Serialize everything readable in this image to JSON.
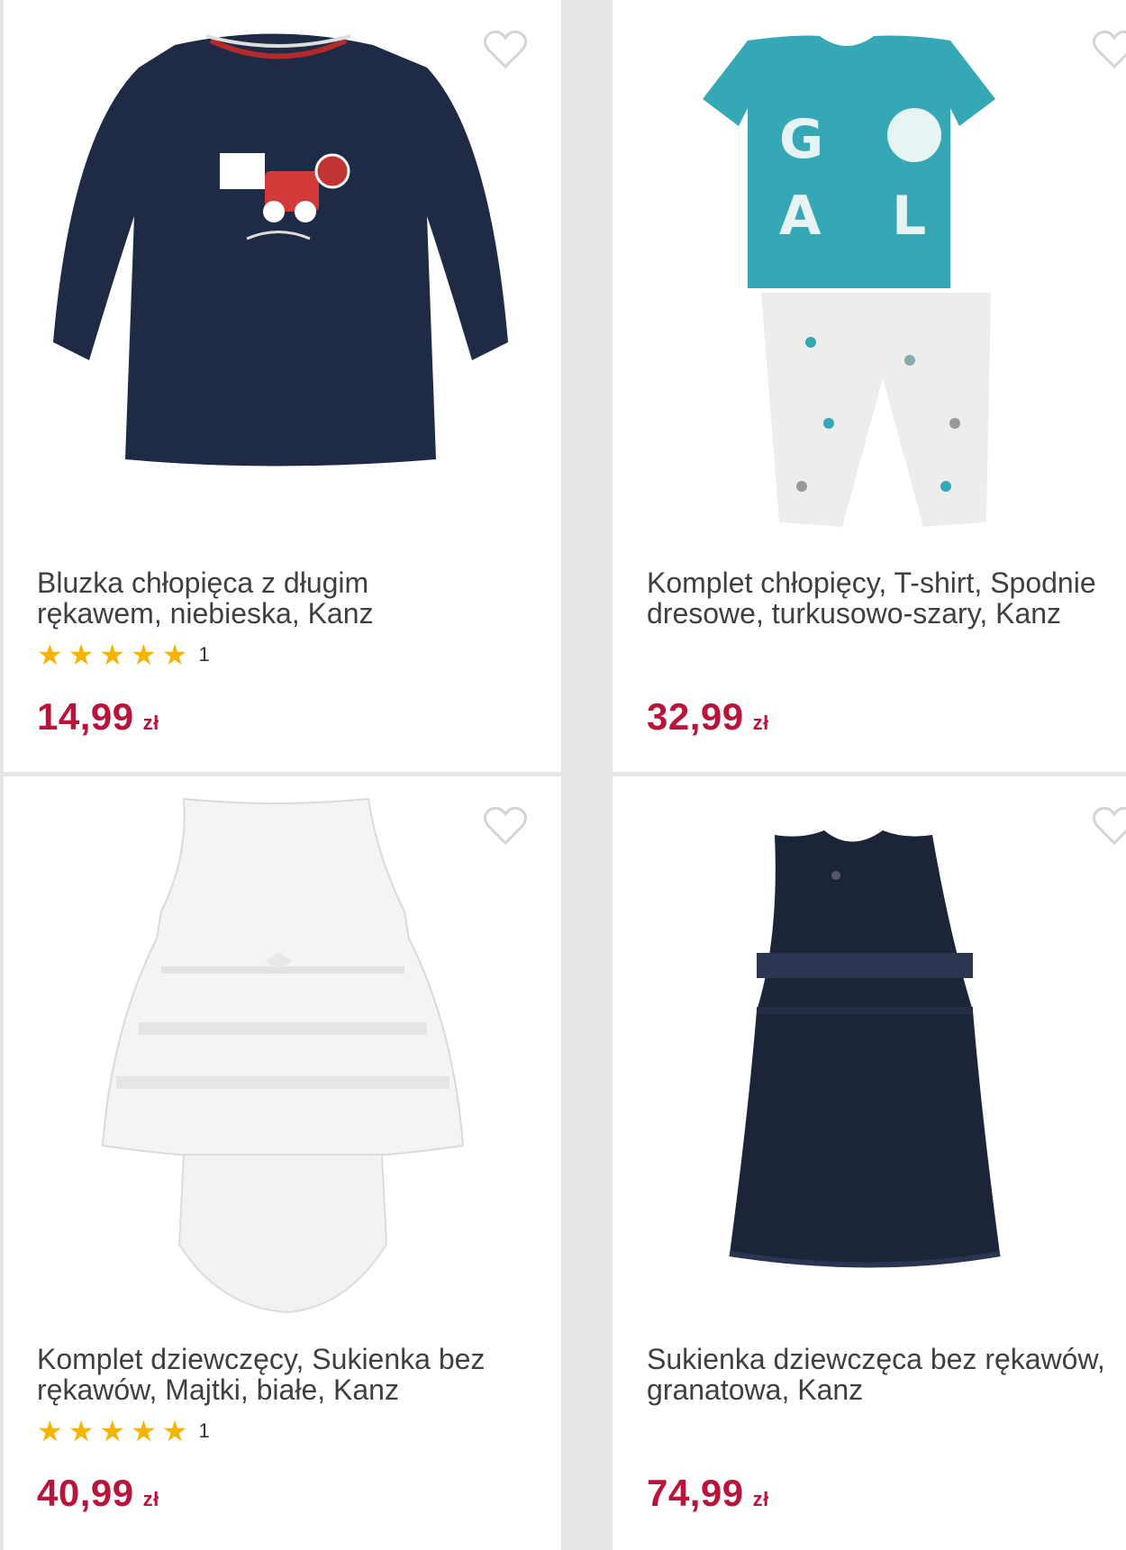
{
  "colors": {
    "price": "#b8143c",
    "star": "#f5b400",
    "title": "#3f3f3f"
  },
  "products": [
    {
      "title_line1": "Bluzka chłopięca z długim",
      "title_line2": "rękawem, niebieska, Kanz",
      "rating_count": "1",
      "rating_stars": 5,
      "price": "14,99",
      "currency": "zł",
      "wishlist_icon": "heart-outline-icon"
    },
    {
      "title_line1": "Komplet chłopięcy, T-shirt, Spodnie",
      "title_line2": "dresowe, turkusowo-szary, Kanz",
      "rating_count": "",
      "price": "32,99",
      "currency": "zł",
      "wishlist_icon": "heart-outline-icon"
    },
    {
      "title_line1": "Komplet dziewczęcy, Sukienka bez",
      "title_line2": "rękawów, Majtki, białe, Kanz",
      "rating_count": "1",
      "rating_stars": 5,
      "price": "40,99",
      "currency": "zł",
      "wishlist_icon": "heart-outline-icon"
    },
    {
      "title_line1": "Sukienka dziewczęca bez rękawów,",
      "title_line2": "granatowa, Kanz",
      "rating_count": "",
      "price": "74,99",
      "currency": "zł",
      "wishlist_icon": "heart-outline-icon"
    }
  ]
}
